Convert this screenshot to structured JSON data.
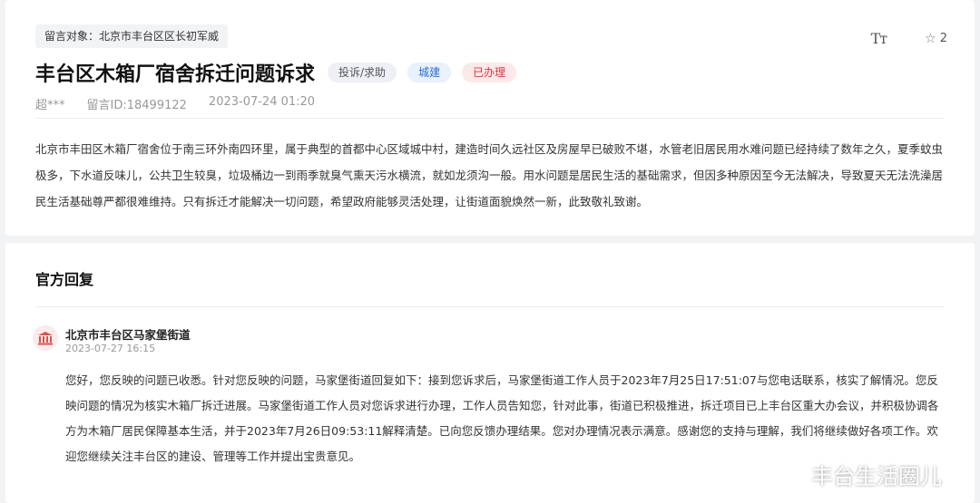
{
  "message": {
    "target_label": "留言对象：北京市丰台区区长初军威",
    "title": "丰台区木箱厂宿舍拆迁问题诉求",
    "tags": [
      "投诉/求助",
      "城建",
      "已办理"
    ],
    "author": "超***",
    "message_id": "留言ID:18499122",
    "datetime": "2023-07-24 01:20",
    "font_size_icon": "Tт",
    "star_count": "2",
    "content": "北京市丰田区木箱厂宿舍位于南三环外南四环里，属于典型的首都中心区域城中村，建造时间久远社区及房屋早已破败不堪，水管老旧居民用水难问题已经持续了数年之久，夏季蚊虫极多，下水道反味儿，公共卫生较臭，垃圾桶边一到雨季就臭气熏天污水横流，就如龙须沟一般。用水问题是居民生活的基础需求，但因多种原因至今无法解决，导致夏天无法洗澡居民生活基础尊严都很难维持。只有拆迁才能解决一切问题，希望政府能够灵活处理，让街道面貌焕然一新，此致敬礼致谢。"
  },
  "reply": {
    "section_title": "官方回复",
    "org": "北京市丰台区马家堡街道",
    "datetime": "2023-07-27 16:15",
    "content": "您好，您反映的问题已收悉。针对您反映的问题，马家堡街道回复如下：接到您诉求后，马家堡街道工作人员于2023年7月25日17:51:07与您电话联系，核实了解情况。您反映问题的情况为核实木箱厂拆迁进展。马家堡街道工作人员对您诉求进行办理，工作人员告知您，针对此事，街道已积极推进，拆迁项目已上丰台区重大办会议，并积极协调各方为木箱厂居民保障基本生活，并于2023年7月26日09:53:11解释清楚。已向您反馈办理结果。您对办理情况表示满意。感谢您的支持与理解，我们将继续做好各项工作。欢迎您继续关注丰台区的建设、管理等工作并提出宝贵意见。"
  },
  "watermark": "丰台生活圈儿",
  "colors": {
    "done_tag": "#d9363e",
    "city_tag": "#2d6fd1",
    "gov_icon": "#d9534f"
  }
}
